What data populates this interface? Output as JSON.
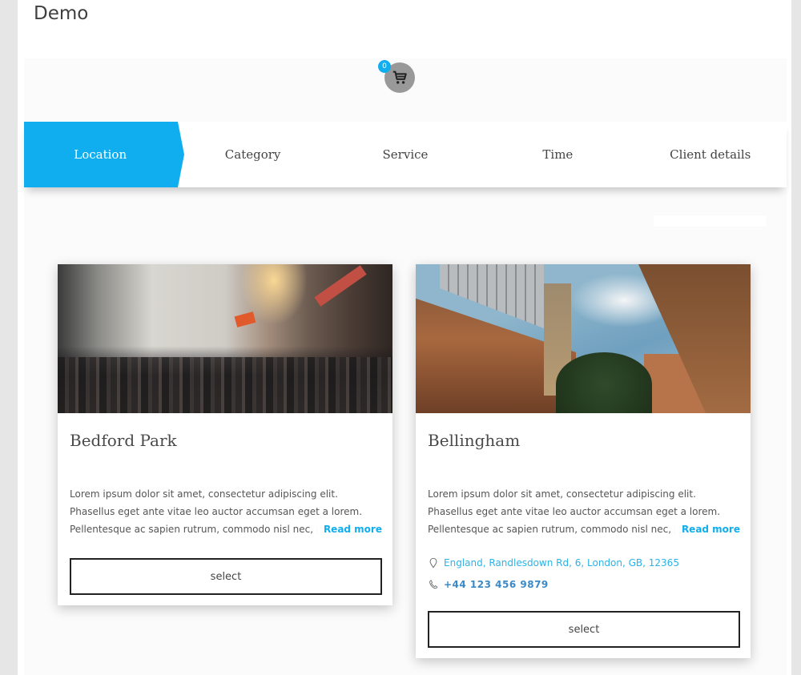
{
  "site": {
    "title": "Demo"
  },
  "cart": {
    "count": "0",
    "icon": "shopping-cart-icon"
  },
  "steps": [
    {
      "label": "Location",
      "active": true
    },
    {
      "label": "Category",
      "active": false
    },
    {
      "label": "Service",
      "active": false
    },
    {
      "label": "Time",
      "active": false
    },
    {
      "label": "Client details",
      "active": false
    }
  ],
  "colors": {
    "accent": "#10aeef",
    "link_address": "#2bb3e8",
    "link_phone": "#3b8ac7"
  },
  "locations": [
    {
      "name": "Bedford Park",
      "image": "city-street-crowd-photo",
      "description_lines": [
        "Lorem ipsum dolor sit amet, consectetur adipiscing elit.",
        "Phasellus eget ante vitae leo auctor accumsan eget a lorem.",
        "Pellentesque ac sapien rutrum, commodo nisl nec, po"
      ],
      "read_more": "Read more",
      "select_label": "select"
    },
    {
      "name": "Bellingham",
      "image": "clock-tower-buildings-photo",
      "description_lines": [
        "Lorem ipsum dolor sit amet, consectetur adipiscing elit.",
        "Phasellus eget ante vitae leo auctor accumsan eget a lorem.",
        "Pellentesque ac sapien rutrum, commodo nisl nec, po"
      ],
      "read_more": "Read more",
      "address": "England, Randlesdown Rd, 6, London, GB, 12365",
      "phone": "+44 123 456 9879",
      "select_label": "select"
    }
  ]
}
